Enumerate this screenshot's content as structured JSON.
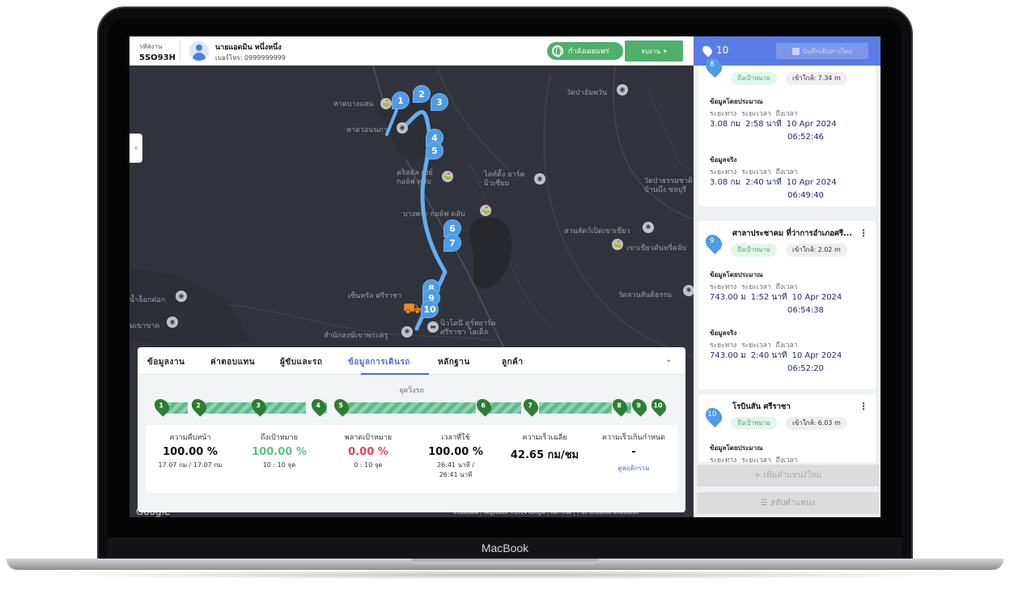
{
  "device": {
    "brand": "MacBook"
  },
  "header": {
    "job_code_label": "รหัสงาน",
    "job_code": "5SO93H",
    "driver_name": "นายแอดมิน หนึ่งหนึ่ง",
    "driver_phone": "เบอร์โทร: 0999999999",
    "live_button": "กำลังเผยแพร่",
    "end_job_button": "จบงาน"
  },
  "map": {
    "labels": [
      "หาดบางแสน",
      "หาดวอนนภา",
      "วัดป่าอัมพวัน",
      "คริสตัล เบย์ กอล์ฟ คลับ",
      "ไลท์ติ้ง ฮาร์ต มิวเซียม",
      "วัดป่าธรรมชาติ บ้านบึง ชลบุรี",
      "บางพระ กอล์ฟ คลับ",
      "สวนสัตว์เปิดเขาเขียว",
      "เขาเขียวคันทรี่คลับ",
      "เซ็นทรัล ศรีราชา",
      "วัดสวนสันติธรรม",
      "น้ำจ็อกค่อก",
      "มเขาขาด",
      "สำนักสงฆ์เขาพระครู",
      "นิวโดนี ดูร์ทยาร์ค ศรีราชา โฮเต็ล"
    ],
    "pins": [
      "1",
      "2",
      "3",
      "4",
      "5",
      "6",
      "7",
      "8",
      "9",
      "10"
    ],
    "google": "Google",
    "footer": "แป้นพิมพ์ลัด | ข้อมูลแผนที่ ©2024 Google | ข้อกำหนด | รายงานข้อผิดพลาดของแผนที่"
  },
  "panel": {
    "tabs": [
      "ข้อมูลงาน",
      "ค่าตอบแทน",
      "ผู้ขับและรถ",
      "ข้อมูลการเดินรถ",
      "หลักฐาน",
      "ลูกค้า"
    ],
    "active_tab": "ข้อมูลการเดินรถ",
    "progress_title": "จุดวิ่งรถ",
    "stops": [
      "1",
      "2",
      "3",
      "4",
      "5",
      "6",
      "7",
      "8",
      "9",
      "10"
    ],
    "stats": [
      {
        "label": "ความคืบหน้า",
        "value": "100.00 %",
        "sub": "17.07 กม / 17.07 กม"
      },
      {
        "label": "ถึงเป้าหมาย",
        "value": "100.00 %",
        "sub": "10 : 10 จุด"
      },
      {
        "label": "พลาดเป้าหมาย",
        "value": "0.00 %",
        "sub": "0 : 10 จุด"
      },
      {
        "label": "เวลาที่ใช้",
        "value": "100.00 %",
        "sub": "26:41 นาที / 26:41 นาที"
      },
      {
        "label": "ความเร็วเฉลี่ย",
        "value": "42.65 กม/ชม",
        "sub": ""
      },
      {
        "label": "ความเร็วเกินกำหนด",
        "value": "-",
        "sub": "ดูพฤติกรรม"
      }
    ]
  },
  "sidebar": {
    "count": "10",
    "save_button": "บันทึกเส้นทางใหม่",
    "cards": [
      {
        "pin": "8",
        "title": "",
        "status": "ถึงเป้าหมาย",
        "near": "เข้าใกล้: 7.34 m",
        "est_label": "ข้อมูลโดยประมาณ",
        "cols": [
          "ระยะทาง",
          "ระยะเวลา",
          "ถึงเวลา"
        ],
        "est_values": [
          "3.08 กม",
          "2:58 นาที",
          "10 Apr 2024",
          "06:52:46"
        ],
        "act_label": "ข้อมูลจริง",
        "act_values": [
          "3.08 กม",
          "2:40 นาที",
          "10 Apr 2024",
          "06:49:40"
        ]
      },
      {
        "pin": "9",
        "title": "ศาลาประชาคม ที่ว่าการอำเภอศรี...",
        "status": "ถึงเป้าหมาย",
        "near": "เข้าใกล้: 2.02 m",
        "est_label": "ข้อมูลโดยประมาณ",
        "cols": [
          "ระยะทาง",
          "ระยะเวลา",
          "ถึงเวลา"
        ],
        "est_values": [
          "743.00 ม",
          "1:52 นาที",
          "10 Apr 2024",
          "06:54:38"
        ],
        "act_label": "ข้อมูลจริง",
        "act_values": [
          "743.00 ม",
          "2:40 นาที",
          "10 Apr 2024",
          "06:52:20"
        ]
      },
      {
        "pin": "10",
        "title": "โรบินสัน ศรีราชา",
        "status": "ถึงเป้าหมาย",
        "near": "เข้าใกล้: 6.03 m",
        "est_label": "ข้อมูลโดยประมาณ",
        "cols": [
          "ระยะทาง",
          "ระยะเวลา",
          "ถึงเวลา"
        ]
      }
    ],
    "add_button": "+ เพิ่มตำแหน่งใหม่",
    "swap_button": "สลับตำแหน่ง"
  }
}
